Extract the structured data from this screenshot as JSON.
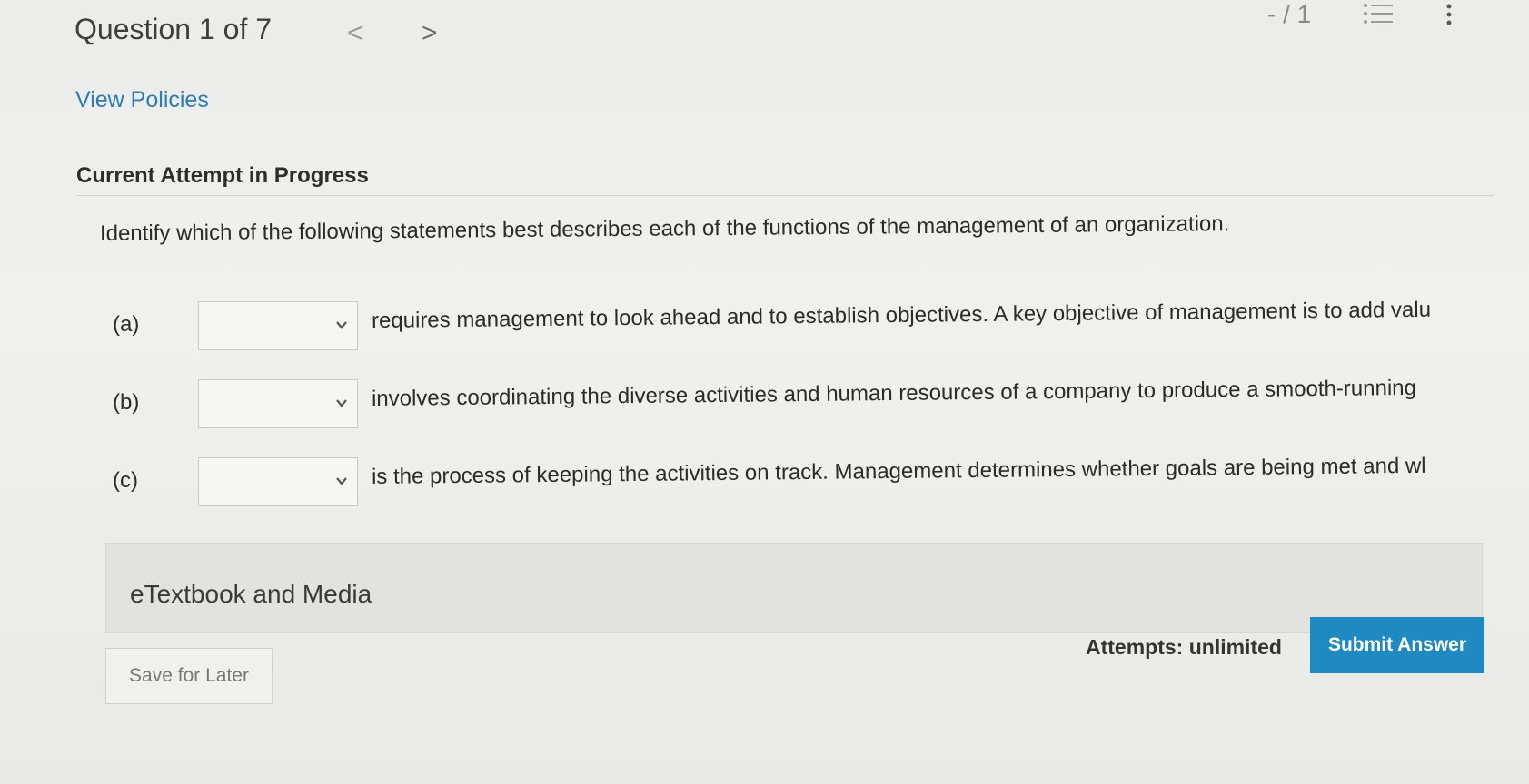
{
  "header": {
    "question_title": "Question 1 of 7",
    "prev_arrow": "<",
    "next_arrow": ">",
    "score": "- / 1",
    "list_icon": "list-icon",
    "more_icon": "more-vertical-icon"
  },
  "links": {
    "view_policies": "View Policies"
  },
  "attempt_heading": "Current Attempt in Progress",
  "instruction": "Identify which of the following statements best describes each of the functions of the management of an organization.",
  "parts": [
    {
      "label": "(a)",
      "selected": "",
      "text": "requires management to look ahead and to establish objectives. A key objective of management is to add valu"
    },
    {
      "label": "(b)",
      "selected": "",
      "text": "involves coordinating the diverse activities and human resources of a company to produce a smooth-running"
    },
    {
      "label": "(c)",
      "selected": "",
      "text": "is the process of keeping the activities on track. Management determines whether goals are being met and wl"
    }
  ],
  "etextbook": "eTextbook and Media",
  "footer": {
    "save_label": "Save for Later",
    "attempts": "Attempts: unlimited",
    "submit_label": "Submit Answer"
  },
  "colors": {
    "link": "#2a7db5",
    "submit_bg": "#1f8ac2"
  }
}
